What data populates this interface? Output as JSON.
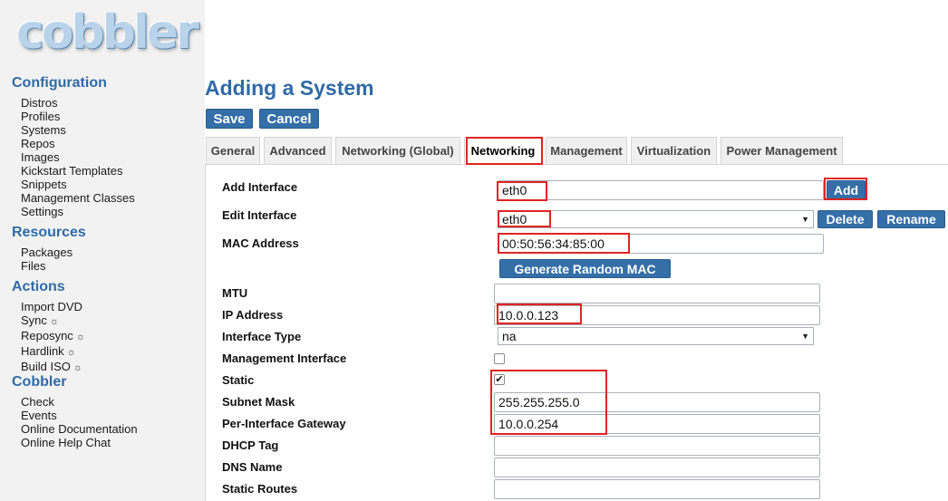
{
  "sidebar": {
    "logo_text": "cobbler",
    "sections": [
      {
        "title": "Configuration",
        "items": [
          "Distros",
          "Profiles",
          "Systems",
          "Repos",
          "Images",
          "Kickstart Templates",
          "Snippets",
          "Management Classes",
          "Settings"
        ]
      },
      {
        "title": "Resources",
        "items": [
          "Packages",
          "Files"
        ]
      },
      {
        "title": "Actions",
        "items": [
          "Import DVD",
          "Sync",
          "Reposync",
          "Hardlink",
          "Build ISO"
        ],
        "gear_icon": "☼"
      },
      {
        "title": "Cobbler",
        "items": [
          "Check",
          "Events",
          "Online Documentation",
          "Online Help Chat"
        ]
      }
    ]
  },
  "main": {
    "title": "Adding a System",
    "save_label": "Save",
    "cancel_label": "Cancel",
    "tabs": [
      "General",
      "Advanced",
      "Networking (Global)",
      "Networking",
      "Management",
      "Virtualization",
      "Power Management"
    ],
    "active_tab": "Networking"
  },
  "form": {
    "add_interface": {
      "label": "Add Interface",
      "value": "eth0",
      "button": "Add"
    },
    "edit_interface": {
      "label": "Edit Interface",
      "value": "eth0",
      "delete_button": "Delete",
      "rename_button": "Rename"
    },
    "mac_address": {
      "label": "MAC Address",
      "value": "00:50:56:34:85:00",
      "generate_button": "Generate Random MAC"
    },
    "mtu": {
      "label": "MTU",
      "value": ""
    },
    "ip_address": {
      "label": "IP Address",
      "value": "10.0.0.123"
    },
    "interface_type": {
      "label": "Interface Type",
      "value": "na"
    },
    "management_interface": {
      "label": "Management Interface",
      "checked": false
    },
    "static": {
      "label": "Static",
      "checked": true,
      "check_glyph": "✔"
    },
    "subnet_mask": {
      "label": "Subnet Mask",
      "value": "255.255.255.0"
    },
    "gateway": {
      "label": "Per-Interface Gateway",
      "value": "10.0.0.254"
    },
    "dhcp_tag": {
      "label": "DHCP Tag",
      "value": ""
    },
    "dns_name": {
      "label": "DNS Name",
      "value": ""
    },
    "static_routes": {
      "label": "Static Routes",
      "value": ""
    }
  },
  "colors": {
    "accent": "#2f6ba7",
    "button": "#346fa8",
    "highlight": "#e02424"
  }
}
